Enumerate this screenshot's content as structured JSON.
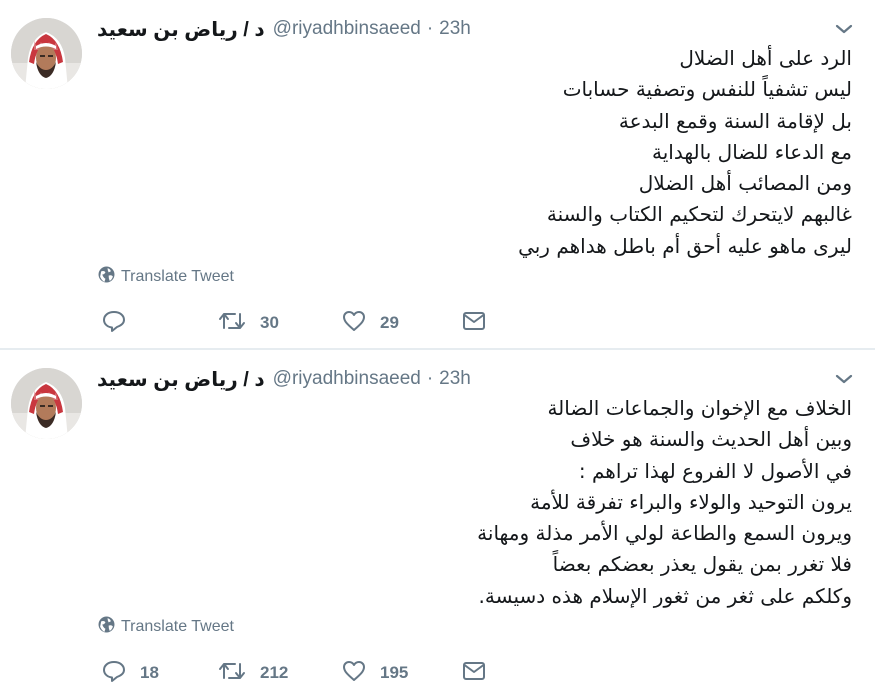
{
  "tweets": [
    {
      "author": {
        "display_name": "د / رياض بن سعيد",
        "handle": "@riyadhbinsaeed"
      },
      "separator": "·",
      "time": "23h",
      "lines": [
        "الرد على أهل الضلال",
        " ليس تشفياً للنفس وتصفية حسابات",
        "بل لإقامة السنة وقمع البدعة",
        "مع الدعاء للضال بالهداية",
        "ومن المصائب أهل الضلال",
        "غالبهم لايتحرك لتحكيم الكتاب والسنة",
        "ليرى ماهو عليه أحق أم باطل هداهم ربي"
      ],
      "translate_label": "Translate Tweet",
      "reply_count": "",
      "retweet_count": "30",
      "like_count": "29"
    },
    {
      "author": {
        "display_name": "د / رياض بن سعيد",
        "handle": "@riyadhbinsaeed"
      },
      "separator": "·",
      "time": "23h",
      "lines": [
        "الخلاف مع الإخوان والجماعات الضالة",
        "وبين أهل الحديث والسنة هو خلاف",
        "في الأصول لا الفروع لهذا تراهم :",
        "يرون التوحيد والولاء والبراء تفرقة للأمة",
        "ويرون السمع والطاعة لولي الأمر مذلة ومهانة",
        "فلا تغرر بمن يقول يعذر بعضكم بعضاً",
        "وكلكم على ثغر من ثغور الإسلام هذه دسيسة."
      ],
      "translate_label": "Translate Tweet",
      "reply_count": "18",
      "retweet_count": "212",
      "like_count": "195"
    }
  ],
  "icons": {
    "avatar": "avatar-image",
    "caret": "chevron-down-icon",
    "globe": "globe-icon",
    "reply": "reply-icon",
    "retweet": "retweet-icon",
    "like": "heart-icon",
    "dm": "envelope-icon"
  },
  "colors": {
    "text": "#14171a",
    "muted": "#657786",
    "divider": "#e6ecf0"
  }
}
